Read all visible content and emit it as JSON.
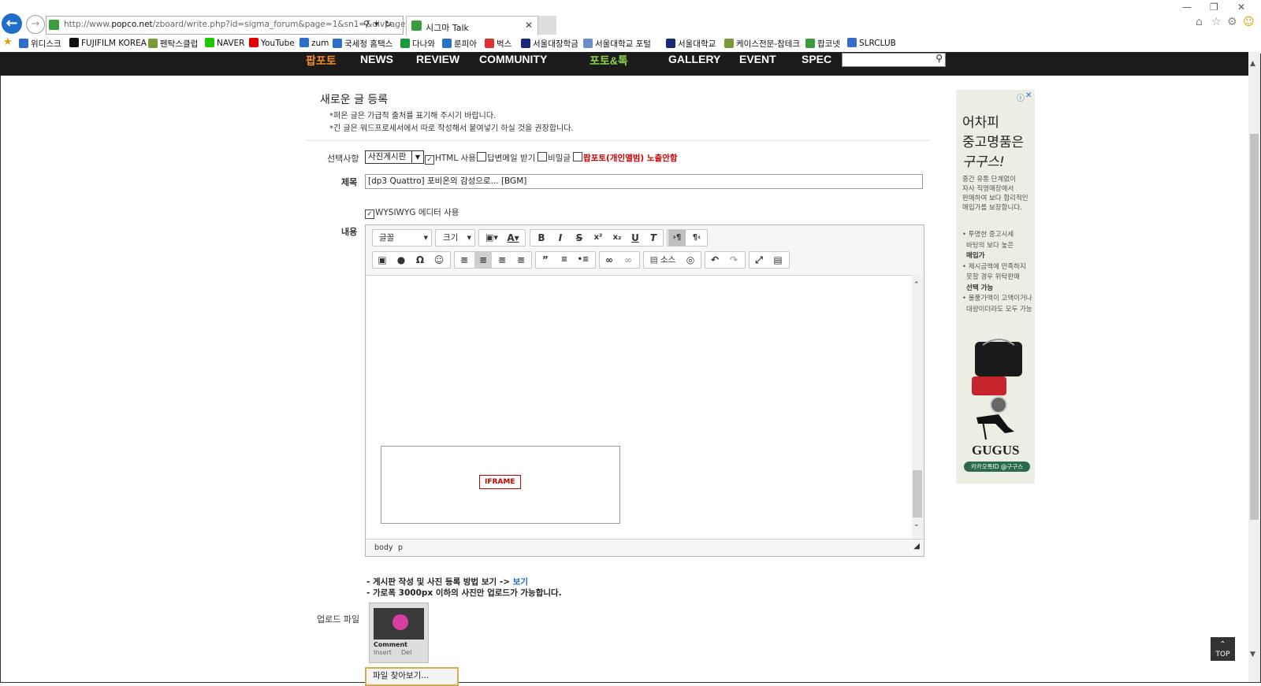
{
  "browser": {
    "url_prefix": "http://www.",
    "url_domain": "popco.net",
    "url_rest": "/zboard/write.php?id=sigma_forum&page=1&sn1=&divpage=1",
    "tab_title": "시그마 Talk"
  },
  "favorites": [
    {
      "label": "위디스크",
      "color": "#2b6fc8"
    },
    {
      "label": "FUJIFILM KOREA",
      "color": "#111111"
    },
    {
      "label": "펜탁스클럽",
      "color": "#7a9a3a"
    },
    {
      "label": "NAVER",
      "color": "#1ec800"
    },
    {
      "label": "YouTube",
      "color": "#e00000"
    },
    {
      "label": "zum",
      "color": "#2b6fc8"
    },
    {
      "label": "국세청 홈택스",
      "color": "#2b6fc8"
    },
    {
      "label": "다나와",
      "color": "#1a9b3a"
    },
    {
      "label": "룬피아",
      "color": "#2b6fc8"
    },
    {
      "label": "벅스",
      "color": "#e03030"
    },
    {
      "label": "서울대장학금",
      "color": "#1a2a7a"
    },
    {
      "label": "서울대학교 포털",
      "color": "#6a8fc8"
    },
    {
      "label": "서울대학교",
      "color": "#1a2a7a"
    },
    {
      "label": "케이스전문-참테크",
      "color": "#7a9a3a"
    },
    {
      "label": "팝코넷",
      "color": "#3a9c3a"
    },
    {
      "label": "SLRCLUB",
      "color": "#3a6ac8"
    }
  ],
  "nav": {
    "items": [
      "팝포토",
      "NEWS",
      "REVIEW",
      "COMMUNITY",
      "포토&톡",
      "GALLERY",
      "EVENT",
      "SPEC"
    ],
    "active_color": "#f08a24",
    "green_color": "#8bd14a"
  },
  "form": {
    "heading": "새로운 글 등록",
    "note1": "*퍼온 글은 가급적 출처를 표기해 주시기 바랍니다.",
    "note2": "*긴 글은 워드프로세서에서 따로 작성해서 붙여넣기 하실 것을 권장합니다.",
    "options_label": "선택사항",
    "board_select": "사진게시판",
    "opt_html": "HTML 사용",
    "opt_reply_mail": "답변메일 받기",
    "opt_secret": "비밀글",
    "opt_album": "팝포토(개인앨범) 노출안함",
    "subject_label": "제목",
    "subject_value": "[dp3 Quattro] 포비온의 감성으로... [BGM]",
    "wysiwyg": "WYSIWYG 에디터 사용",
    "content_label": "내용",
    "font_dd": "글꼴",
    "size_dd": "크기",
    "source_btn": "소스",
    "iframe_label": "IFRAME",
    "status_body": "body",
    "status_p": "p",
    "guide1": "- 게시판 작성 및 사진 등록 방법 보기 -> ",
    "guide1_link": "보기",
    "guide2": "- 가로폭 3000px 이하의 사진만 업로드가 가능합니다.",
    "upload_label": "업로드 파일",
    "thumb_comment": "Comment",
    "thumb_insert": "Insert",
    "thumb_del": "Del",
    "file_button": "파일 찾아보기..."
  },
  "ad": {
    "title1": "어차피",
    "title2": "중고명품은",
    "title3": "구구스!",
    "desc1": "중간 유통 단계없이",
    "desc2": "자사 직영매장에서",
    "desc3": "판매하여 보다 합리적인",
    "desc4": "매입가를 보장합니다.",
    "b1a": "• 투명한 중고시세",
    "b1b": "바탕의 보다 높은",
    "b1c": "매입가",
    "b2a": "• 제시금액에 만족하지",
    "b2b": "못할 경우 위탁판매",
    "b2c": "선택 가능",
    "b3a": "• 물품가액이 고액이거나",
    "b3b": "대량이더라도 모두 가능",
    "brand": "GUGUS",
    "kakao": "카카오톡ID @구구스"
  },
  "top_button": "TOP"
}
